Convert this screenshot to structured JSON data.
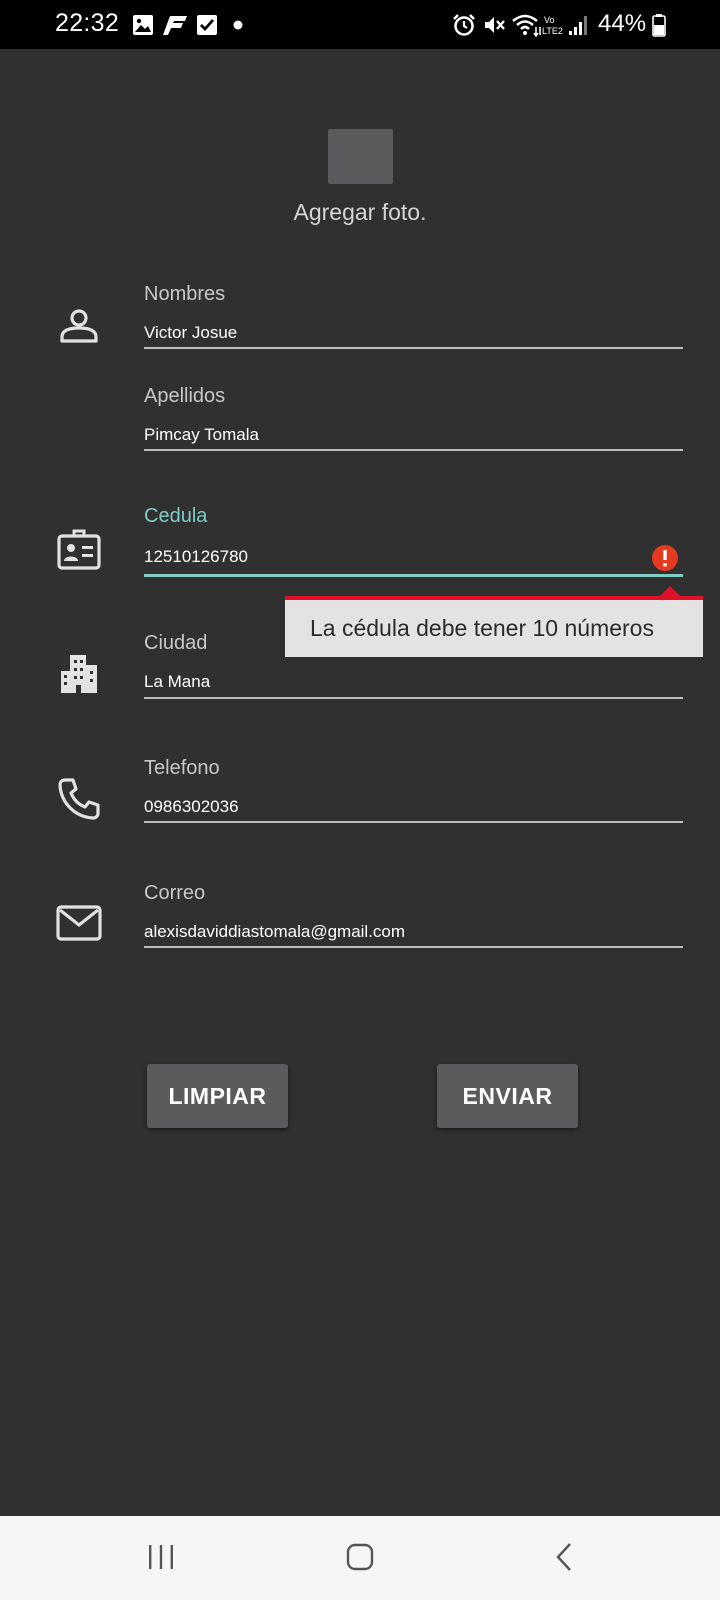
{
  "status_bar": {
    "time": "22:32",
    "battery": "44%",
    "icons": [
      "gallery-icon",
      "f-app-icon",
      "checkbox-icon",
      "dot-icon",
      "alarm-icon",
      "mute-icon",
      "wifi-icon",
      "volte-icon",
      "signal-icon",
      "battery-icon"
    ]
  },
  "photo": {
    "label": "Agregar foto."
  },
  "form": {
    "nombres": {
      "label": "Nombres",
      "value": "Victor Josue",
      "icon": "person-icon"
    },
    "apellidos": {
      "label": "Apellidos",
      "value": "Pimcay Tomala"
    },
    "cedula": {
      "label": "Cedula",
      "value": "12510126780",
      "icon": "id-card-icon",
      "error": "La cédula debe tener 10 números"
    },
    "ciudad": {
      "label": "Ciudad",
      "value": "La Mana",
      "icon": "building-icon"
    },
    "telefono": {
      "label": "Telefono",
      "value": "0986302036",
      "icon": "phone-icon"
    },
    "correo": {
      "label": "Correo",
      "value": "alexisdaviddiastomala@gmail.com",
      "icon": "mail-icon"
    }
  },
  "buttons": {
    "clear": "LIMPIAR",
    "send": "ENVIAR"
  },
  "colors": {
    "background": "#303030",
    "accent": "#80cbc4",
    "error": "#e0102a"
  },
  "nav_bar": {
    "icons": [
      "recents-icon",
      "home-icon",
      "back-icon"
    ]
  }
}
